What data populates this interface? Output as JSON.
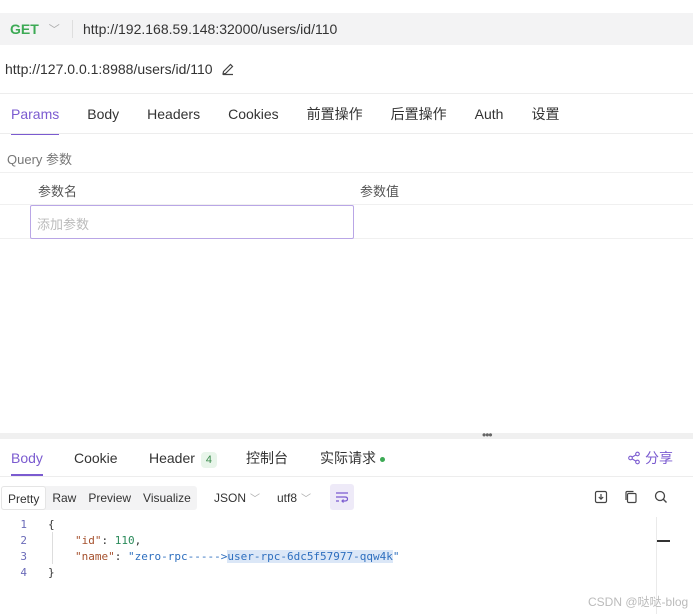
{
  "request": {
    "method": "GET",
    "url": "http://192.168.59.148:32000/users/id/110",
    "title_url": "http://127.0.0.1:8988/users/id/110"
  },
  "tabs": [
    {
      "label": "Params",
      "active": true
    },
    {
      "label": "Body"
    },
    {
      "label": "Headers"
    },
    {
      "label": "Cookies"
    },
    {
      "label": "前置操作"
    },
    {
      "label": "后置操作"
    },
    {
      "label": "Auth"
    },
    {
      "label": "设置"
    }
  ],
  "params": {
    "section_label": "Query 参数",
    "col_name": "参数名",
    "col_value": "参数值",
    "add_placeholder": "添加参数"
  },
  "response": {
    "tabs": {
      "body": "Body",
      "cookie": "Cookie",
      "header": "Header",
      "header_count": "4",
      "console": "控制台",
      "actual_request": "实际请求"
    },
    "share": "分享",
    "formats": [
      "Pretty",
      "Raw",
      "Preview",
      "Visualize"
    ],
    "format_selected": "Pretty",
    "language": "JSON",
    "encoding": "utf8",
    "code": {
      "line_numbers": [
        "1",
        "2",
        "3",
        "4"
      ],
      "open_brace": "{",
      "close_brace": "}",
      "id_key": "\"id\"",
      "id_value": "110",
      "name_key": "\"name\"",
      "name_value_prefix": "\"zero-rpc----->",
      "name_value_selected": "user-rpc-6dc5f57977-qqw4k",
      "name_value_suffix": "\""
    }
  },
  "watermark": "CSDN @哒哒-blog",
  "colors": {
    "accent": "#7b5bd0",
    "method_get": "#3daa55"
  }
}
